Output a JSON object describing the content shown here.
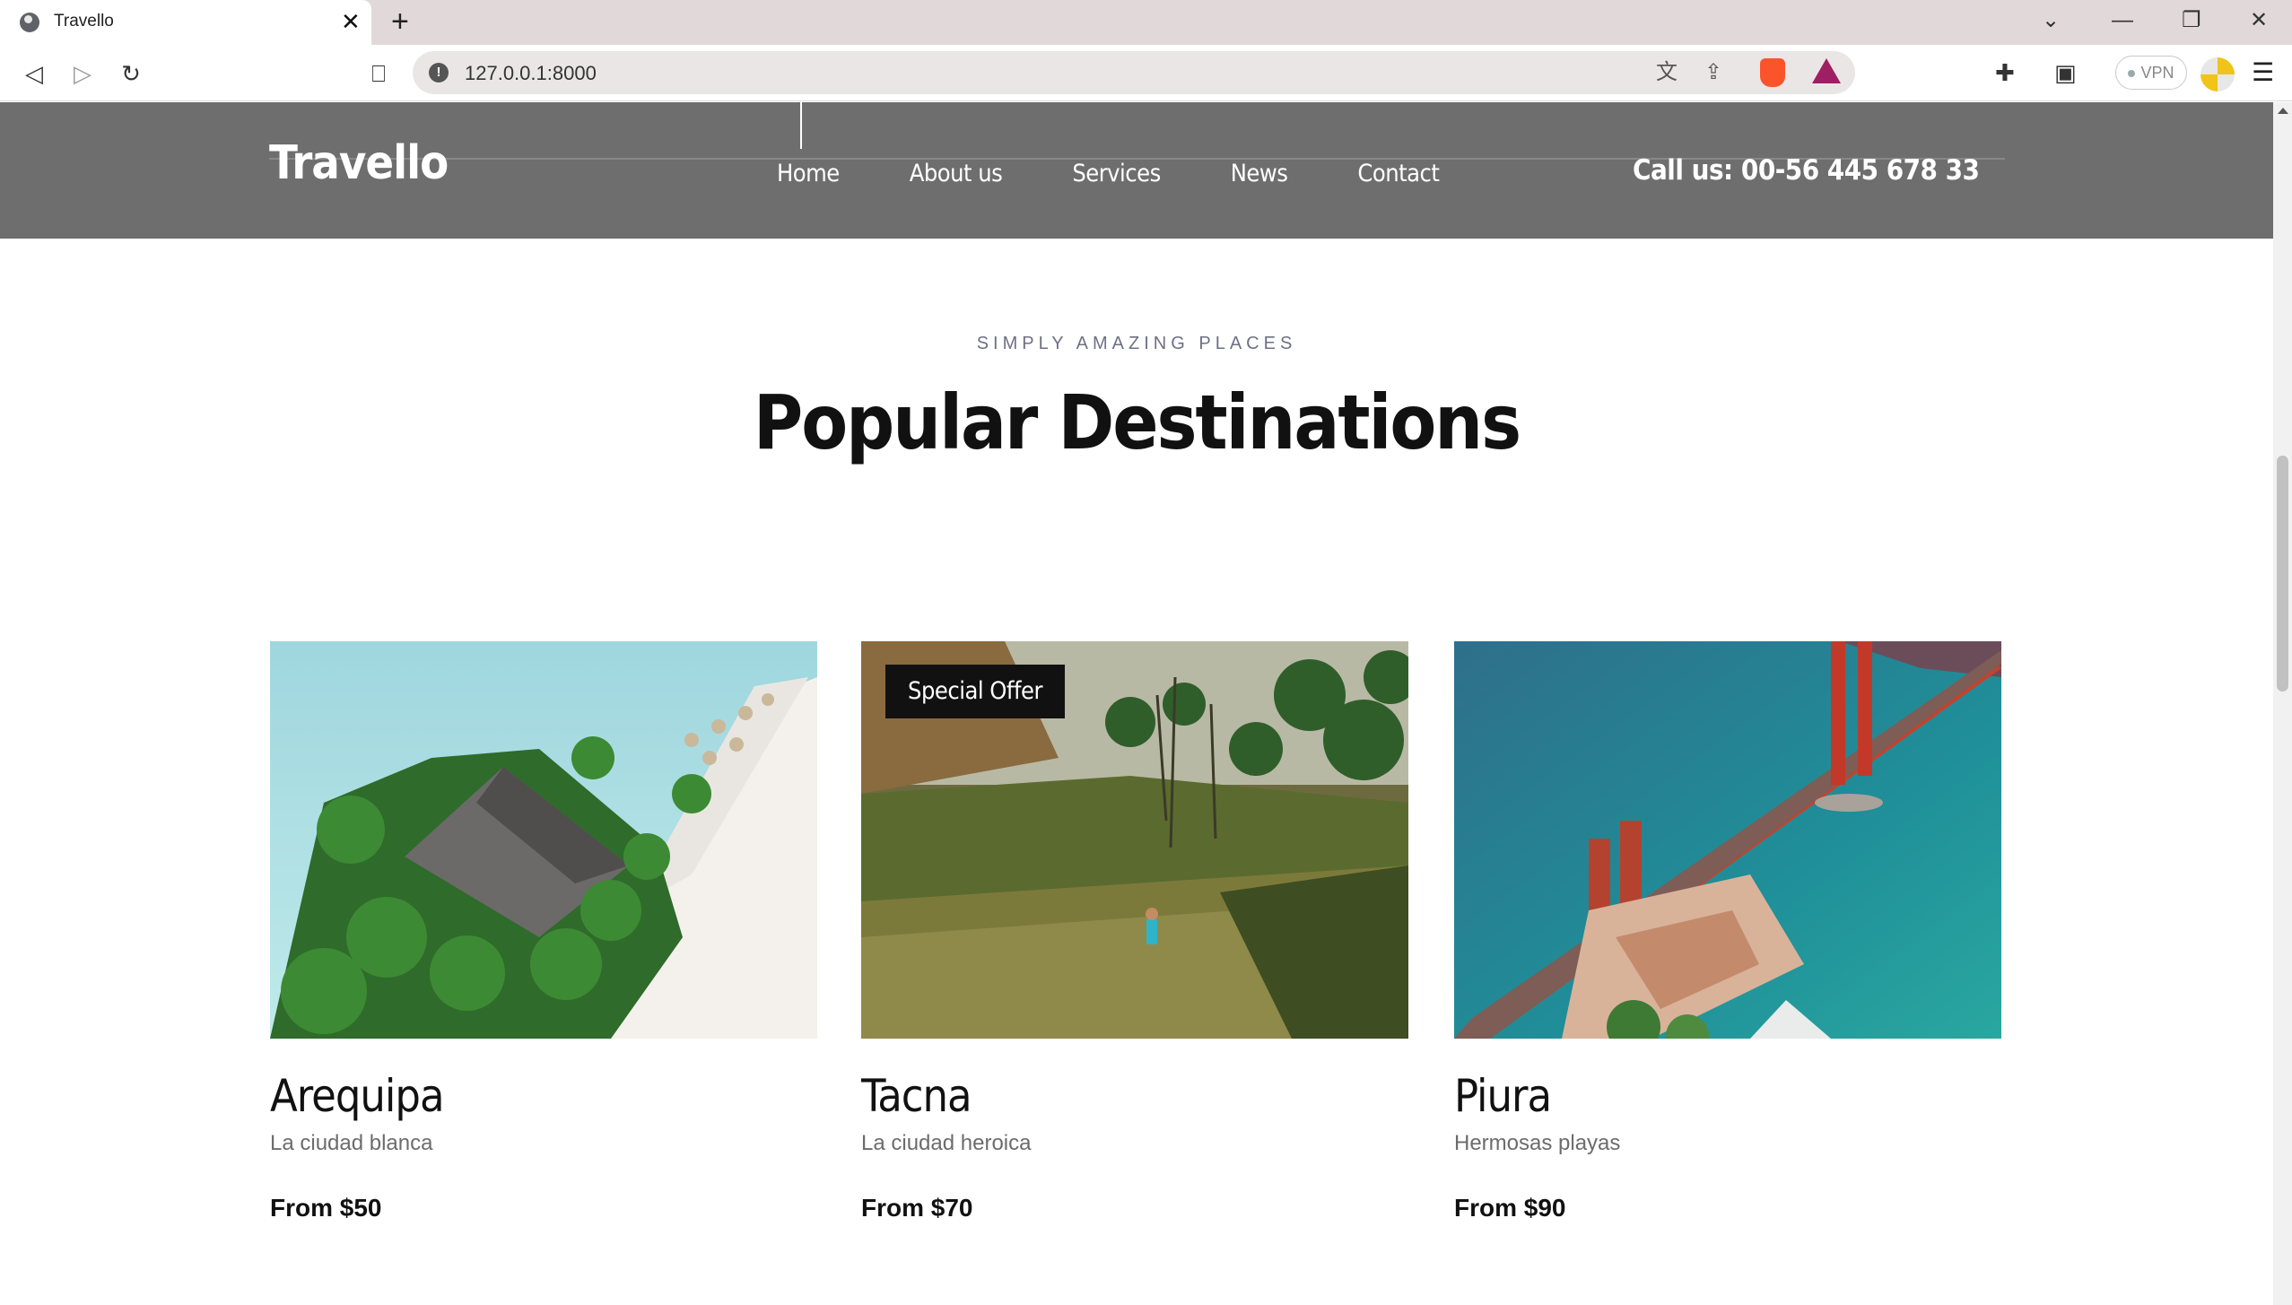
{
  "browser": {
    "tab_title": "Travello",
    "url": "127.0.0.1:8000",
    "vpn_label": "VPN"
  },
  "site": {
    "logo": "Travello",
    "nav": [
      "Home",
      "About us",
      "Services",
      "News",
      "Contact"
    ],
    "phone": "Call us: 00-56 445 678 33"
  },
  "section": {
    "eyebrow": "SIMPLY AMAZING PLACES",
    "title": "Popular Destinations"
  },
  "destinations": [
    {
      "name": "Arequipa",
      "subtitle": "La ciudad blanca",
      "price": "From $50",
      "image": "tropical-island-beach"
    },
    {
      "name": "Tacna",
      "subtitle": "La ciudad heroica",
      "price": "From $70",
      "image": "rice-terraces-jungle",
      "badge": "Special Offer"
    },
    {
      "name": "Piura",
      "subtitle": "Hermosas playas",
      "price": "From $90",
      "image": "golden-gate-bridge"
    }
  ]
}
